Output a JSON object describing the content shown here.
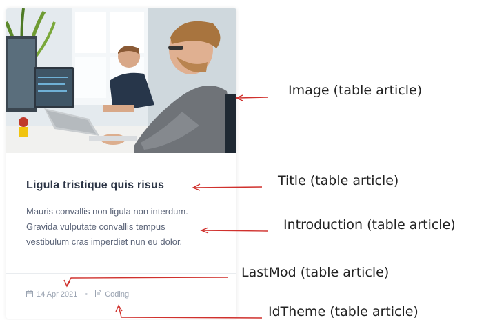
{
  "card": {
    "title": "Ligula tristique quis risus",
    "intro_lines": [
      "Mauris convallis non ligula non interdum.",
      "Gravida vulputate convallis tempus",
      "vestibulum cras imperdiet nun eu dolor."
    ],
    "date": "14 Apr 2021",
    "category": "Coding",
    "date_icon": "calendar-icon",
    "category_icon": "document-icon"
  },
  "annotations": {
    "image": "Image (table article)",
    "title": "Title (table article)",
    "introduction": "Introduction (table article)",
    "lastmod": "LastMod (table article)",
    "idtheme": "IdTheme (table article)"
  },
  "colors": {
    "annotation_arrow": "#d0312d",
    "title": "#2b3445",
    "body_text": "#5b6478",
    "meta_text": "#9aa3b1"
  }
}
